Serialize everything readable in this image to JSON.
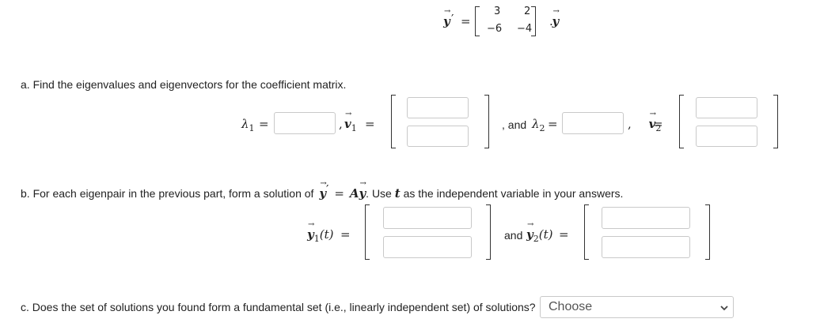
{
  "top_equation": {
    "lhs": "y",
    "prime": "′",
    "equals": "=",
    "matrix": [
      [
        "3",
        "2"
      ],
      [
        "−6",
        "−4"
      ]
    ],
    "rhs": "y",
    "period": "."
  },
  "part_a": {
    "prompt": "a. Find the eigenvalues and eigenvectors for the coefficient matrix.",
    "lambda1_label": "λ",
    "lambda1_sub": "1",
    "v1_label": "v",
    "v1_sub": "1",
    "and_text": ", and",
    "lambda2_label": "λ",
    "lambda2_sub": "2",
    "v2_label": "v",
    "v2_sub": "2",
    "equals": "=",
    "comma": ","
  },
  "part_b": {
    "prompt_prefix": "b. For each eigenpair in the previous part, form a solution of",
    "y_label": "y",
    "prime": "′",
    "equals": "=",
    "A_label": "A",
    "prompt_suffix": ". Use",
    "t_var": "t",
    "prompt_end": "as the independent variable in your answers.",
    "y1_label": "y",
    "y1_sub": "1",
    "t_arg": "(t)",
    "and_text": "and",
    "y2_label": "y",
    "y2_sub": "2"
  },
  "part_c": {
    "prompt": "c. Does the set of solutions you found form a fundamental set (i.e., linearly independent set) of solutions?",
    "select_value": "Choose"
  },
  "arrow_glyph": "⃗"
}
